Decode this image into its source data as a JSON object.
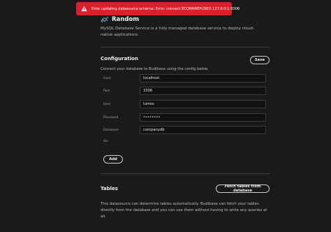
{
  "toast": {
    "message": "Error updating datasource schema: Error: connect ECONNREFUSED 127.0.0.1:3306",
    "color": "#e01e2b",
    "icon": "alert-triangle-icon"
  },
  "datasource": {
    "icon": "mysql-icon",
    "title": "Random",
    "description": "MySQL Database Service is a fully managed database service to deploy cloud-native applications."
  },
  "configuration": {
    "title": "Configuration",
    "save_label": "Save",
    "hint": "Connect your database to Budibase using the config below.",
    "fields": [
      {
        "label": "Host",
        "value": "localhost"
      },
      {
        "label": "Port",
        "value": "3306"
      },
      {
        "label": "User",
        "value": "lumos"
      },
      {
        "label": "Password",
        "value": "••••••••"
      },
      {
        "label": "Database",
        "value": "companydb"
      },
      {
        "label": "Ssl",
        "value": ""
      }
    ],
    "add_label": "Add"
  },
  "tables": {
    "title": "Tables",
    "fetch_label": "Fetch tables from database",
    "description": "This datasource can determine tables automatically. Budibase can fetch your tables directly from the database and you can use them without having to write any queries at all."
  }
}
